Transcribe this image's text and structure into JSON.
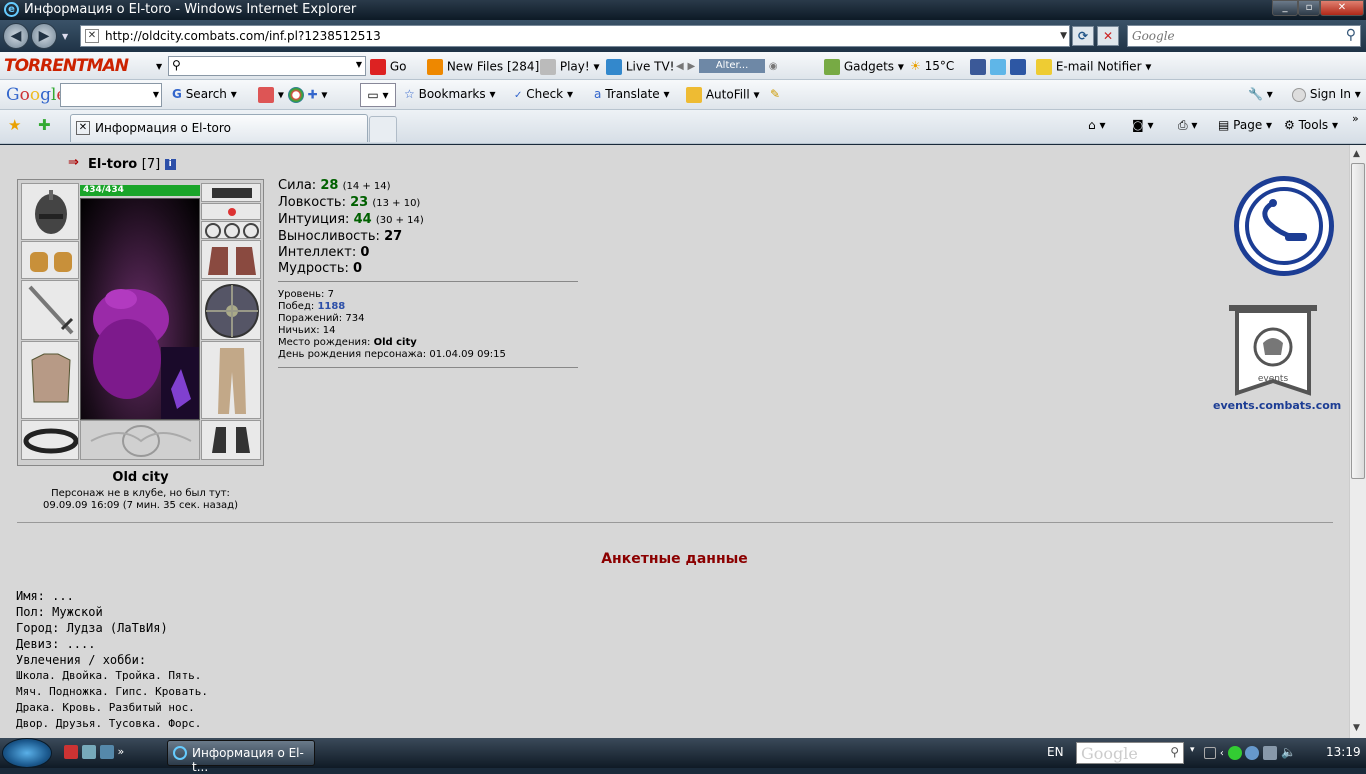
{
  "window": {
    "title": "Информация о El-toro - Windows Internet Explorer"
  },
  "address": {
    "url": "http://oldcity.combats.com/inf.pl?1238512513",
    "search_placeholder": "Google"
  },
  "toolbar1": {
    "logo": "TORRENTMAN",
    "go_label": "Go",
    "new_files_label": "New Files",
    "new_files_count": "[284]",
    "play_label": "Play!",
    "live_tv_label": "Live TV!",
    "player_label": "Alter...",
    "gadgets_label": "Gadgets",
    "weather": "15°C",
    "email_label": "E-mail Notifier"
  },
  "toolbar2": {
    "google_logo": "Google",
    "search_label": "Search",
    "bookmarks_label": "Bookmarks",
    "check_label": "Check",
    "translate_label": "Translate",
    "autofill_label": "AutoFill",
    "signin_label": "Sign In"
  },
  "tabbar": {
    "active_tab": "Информация о El-toro",
    "page_label": "Page",
    "tools_label": "Tools"
  },
  "character": {
    "nick": "El-toro",
    "level": "[7]",
    "info_icon": "i",
    "hp": "434/434",
    "city": "Old city",
    "status_line1": "Персонаж не в клубе, но был тут:",
    "status_line2": "09.09.09 16:09 (7 мин. 35 сек. назад)"
  },
  "stats": [
    {
      "label": "Сила:",
      "value": "28",
      "extra": "(14 + 14)"
    },
    {
      "label": "Ловкость:",
      "value": "23",
      "extra": "(13 + 10)"
    },
    {
      "label": "Интуиция:",
      "value": "44",
      "extra": "(30 + 14)"
    },
    {
      "label": "Выносливость:",
      "value": "27",
      "extra": ""
    },
    {
      "label": "Интеллект:",
      "value": "0",
      "extra": ""
    },
    {
      "label": "Мудрость:",
      "value": "0",
      "extra": ""
    }
  ],
  "record": {
    "level_label": "Уровень:",
    "level_value": "7",
    "wins_label": "Побед:",
    "wins_value": "1188",
    "losses_label": "Поражений:",
    "losses_value": "734",
    "draws_label": "Ничьих:",
    "draws_value": "14",
    "birthplace_label": "Место рождения:",
    "birthplace_value": "Old city",
    "birthday_label": "День рождения персонажа:",
    "birthday_value": "01.04.09 09:15"
  },
  "events": {
    "banner_text": "events",
    "link": "events.combats.com"
  },
  "profile": {
    "heading": "Анкетные данные",
    "name": "Имя: ...",
    "gender": "Пол: Мужской",
    "city": "Город: Лудза (ЛаТвИя)",
    "motto": "Девиз: ....",
    "hobby_label": "Увлечения / хобби:",
    "hobby": [
      "Школа. Двойка. Тройка. Пять.",
      "Мяч. Подножка. Гипс. Кровать.",
      "Драка. Кровь. Разбитый нос.",
      "Двор. Друзья. Тусовка. Форс."
    ]
  },
  "taskbar": {
    "task_label": "Информация о El-t...",
    "lang": "EN",
    "time": "13:19",
    "google_logo": "Google"
  },
  "colors": {
    "stat_value": "#006000",
    "heading": "#8b0000",
    "link": "#1c3d94",
    "hp_bar": "#1aa52a"
  }
}
